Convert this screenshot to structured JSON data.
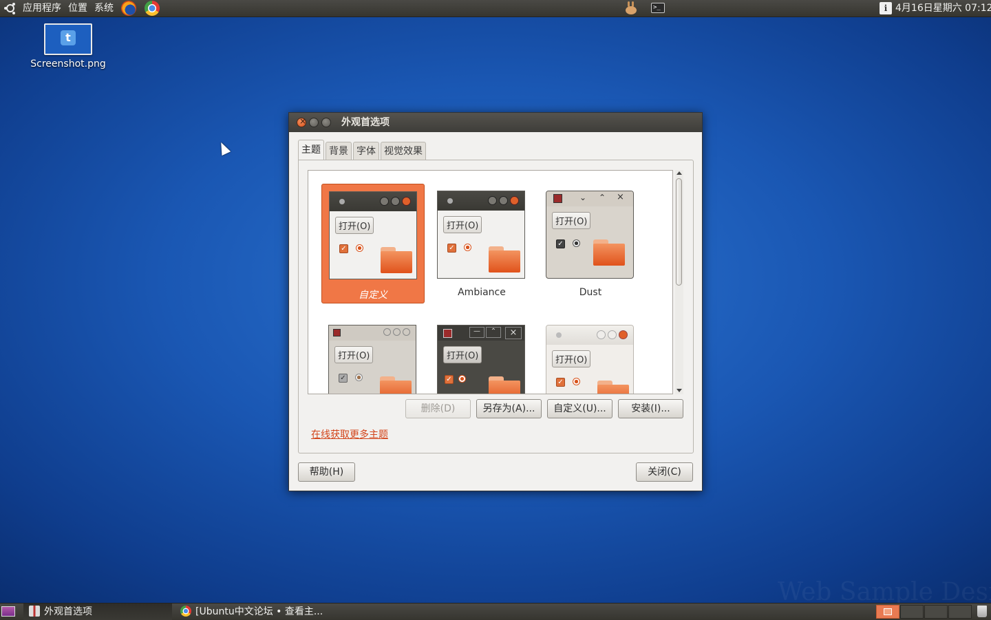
{
  "top_panel": {
    "menus": [
      "应用程序",
      "位置",
      "系统"
    ],
    "clock": "4月16日星期六 07:12",
    "info_glyph": "i",
    "terminal_glyph": ">_"
  },
  "desktop": {
    "icon_label": "Screenshot.png",
    "icon_glyph": "t"
  },
  "dialog": {
    "title": "外观首选项",
    "tabs": [
      "主题",
      "背景",
      "字体",
      "视觉效果"
    ],
    "themes": [
      {
        "name": "自定义",
        "selected": true
      },
      {
        "name": "Ambiance",
        "selected": false
      },
      {
        "name": "Dust",
        "selected": false
      },
      {
        "name": "",
        "selected": false
      },
      {
        "name": "",
        "selected": false
      },
      {
        "name": "",
        "selected": false
      }
    ],
    "preview_button": "打开(O)",
    "buttons": {
      "delete": "删除(D)",
      "save_as": "另存为(A)...",
      "customize": "自定义(U)...",
      "install": "安装(I)..."
    },
    "online_link": "在线获取更多主题",
    "help": "帮助(H)",
    "close": "关闭(C)"
  },
  "taskbar": {
    "tasks": [
      "外观首选项",
      "[Ubuntu中文论坛 • 查看主..."
    ]
  },
  "colors": {
    "accent": "#f07746",
    "panel": "#3c3b37",
    "desktop": "#1a57b3"
  }
}
